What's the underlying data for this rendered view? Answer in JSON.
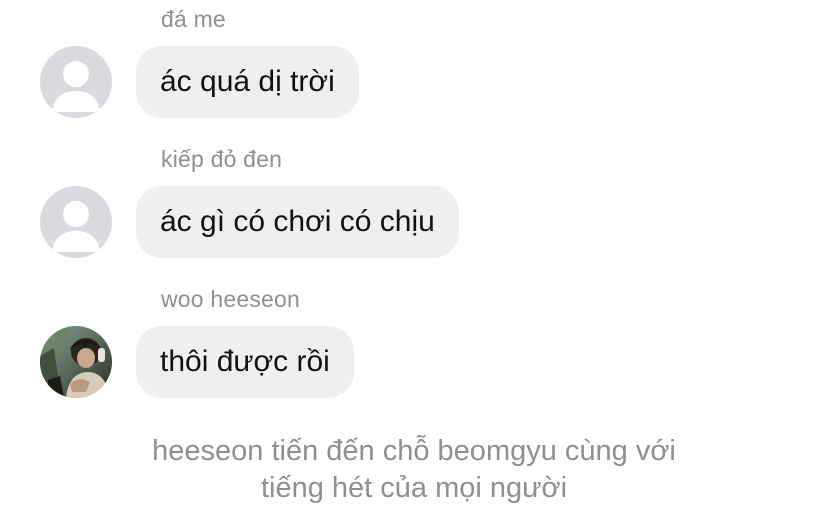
{
  "messages": [
    {
      "sender": "đá me",
      "text": "ác quá dị trời",
      "avatar": "default-avatar-icon"
    },
    {
      "sender": "kiếp đỏ đen",
      "text": "ác gì có chơi có chịu",
      "avatar": "default-avatar-icon"
    },
    {
      "sender": "woo heeseon",
      "text": "thôi được rồi",
      "avatar": "photo-avatar"
    }
  ],
  "system_notice": {
    "line1": "heeseon tiến đến chỗ beomgyu cùng với",
    "line2": "tiếng hét của mọi người"
  },
  "colors": {
    "bubble": "#efeff1",
    "sender": "#8e8e93",
    "text": "#111111",
    "default_avatar_bg": "#d9d9de"
  }
}
